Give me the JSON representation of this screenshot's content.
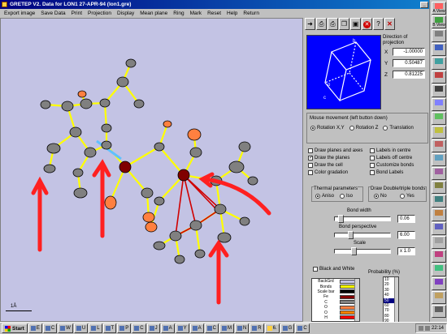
{
  "window": {
    "title": "GRETEP V2. Data for   LON1 27-APR-94 (lon1.gre)"
  },
  "menu": [
    "Export image",
    "Save Data",
    "Print",
    "Projection",
    "Display",
    "Mean plane",
    "Ring",
    "Mark",
    "Reset",
    "Help",
    "Return"
  ],
  "viewport": {
    "scale_label": "1Å",
    "background_color": "#c3c3e4"
  },
  "toolbar": {
    "buttons": [
      "arrow-right-icon",
      "print-icon",
      "print-icon",
      "copy-icon",
      "save-icon",
      "stop-icon",
      "help-icon",
      "close-icon"
    ],
    "help_label": "?",
    "close_label": "✕",
    "stop_label": "✕"
  },
  "projection": {
    "title": "Direction of projection",
    "x_label": "X",
    "y_label": "Y",
    "z_label": "Z",
    "x": "-1.00000",
    "y": "0.50487",
    "z": "0.81225"
  },
  "mouse": {
    "title": "Mouse movement (left button down)",
    "options": [
      "Rotation X,Y",
      "Rotation Z",
      "Translation"
    ],
    "selected": 0
  },
  "options": {
    "draw_planes_axes": "Draw planes and axes",
    "draw_the_planes": "Draw the planes",
    "draw_the_cell": "Draw the cell",
    "color_gradation": "Color gradation",
    "labels_in_centre": "Labels in centre",
    "labels_off_centre": "Labels off centre",
    "customize_bonds": "Customize  bonds",
    "bond_labels": "Bond Labels",
    "thermal_title": "Thermal parameters",
    "thermal_aniso": "Aniso",
    "thermal_iso": "Iso",
    "dbl_title": "Draw Double/triple bonds",
    "dbl_no": "No",
    "dbl_yes": "Yes",
    "bond_width_label": "Bond width",
    "bond_width": "0.06",
    "bond_persp_label": "Bond perspective",
    "bond_persp": "6.00",
    "scale_label": "Scale",
    "scale": "x 1.0",
    "black_white": "Black and White",
    "probability_label": "Probability (%)"
  },
  "colors": [
    {
      "name": "BackGrd",
      "color": "#c3c3e4"
    },
    {
      "name": "Bonds",
      "color": "#ffff00"
    },
    {
      "name": "Scale bar",
      "color": "#000000"
    },
    {
      "name": "Fe",
      "color": "#800000"
    },
    {
      "name": "C",
      "color": "#808080"
    },
    {
      "name": "O",
      "color": "#ff8040"
    },
    {
      "name": "O",
      "color": "#ff8000"
    },
    {
      "name": "H",
      "color": "#ff0000"
    }
  ],
  "probabilities": [
    "10",
    "20",
    "30",
    "40",
    "50",
    "60",
    "70",
    "80",
    "90"
  ],
  "probability_selected": 4,
  "side_strip": [
    {
      "name": "A View",
      "color": "#ff6060"
    },
    {
      "name": "B View",
      "color": "#40a040"
    },
    {
      "name": "",
      "color": "#808080"
    },
    {
      "name": "",
      "color": "#4060c0"
    },
    {
      "name": "",
      "color": "#40a0a0"
    },
    {
      "name": "",
      "color": "#c04040"
    },
    {
      "name": "",
      "color": "#404040"
    },
    {
      "name": "",
      "color": "#8080ff"
    },
    {
      "name": "",
      "color": "#60c060"
    },
    {
      "name": "",
      "color": "#c0c040"
    },
    {
      "name": "",
      "color": "#c06060"
    },
    {
      "name": "",
      "color": "#60a0c0"
    },
    {
      "name": "",
      "color": "#a060a0"
    },
    {
      "name": "",
      "color": "#808040"
    },
    {
      "name": "",
      "color": "#408080"
    },
    {
      "name": "",
      "color": "#c08040"
    },
    {
      "name": "",
      "color": "#6060c0"
    },
    {
      "name": "",
      "color": "#a0a0a0"
    },
    {
      "name": "",
      "color": "#c04080"
    },
    {
      "name": "",
      "color": "#40c080"
    },
    {
      "name": "",
      "color": "#8040c0"
    },
    {
      "name": "",
      "color": "#c0a060"
    },
    {
      "name": "",
      "color": "#606060"
    }
  ],
  "taskbar": {
    "start": "Start",
    "items": [
      "E",
      "C",
      "W",
      "U",
      "L",
      "T",
      "P",
      "C",
      "J",
      "A",
      "Y",
      "A",
      "C",
      "M",
      "N",
      "R",
      "6.",
      "G",
      "C"
    ],
    "clock": "22:14"
  }
}
